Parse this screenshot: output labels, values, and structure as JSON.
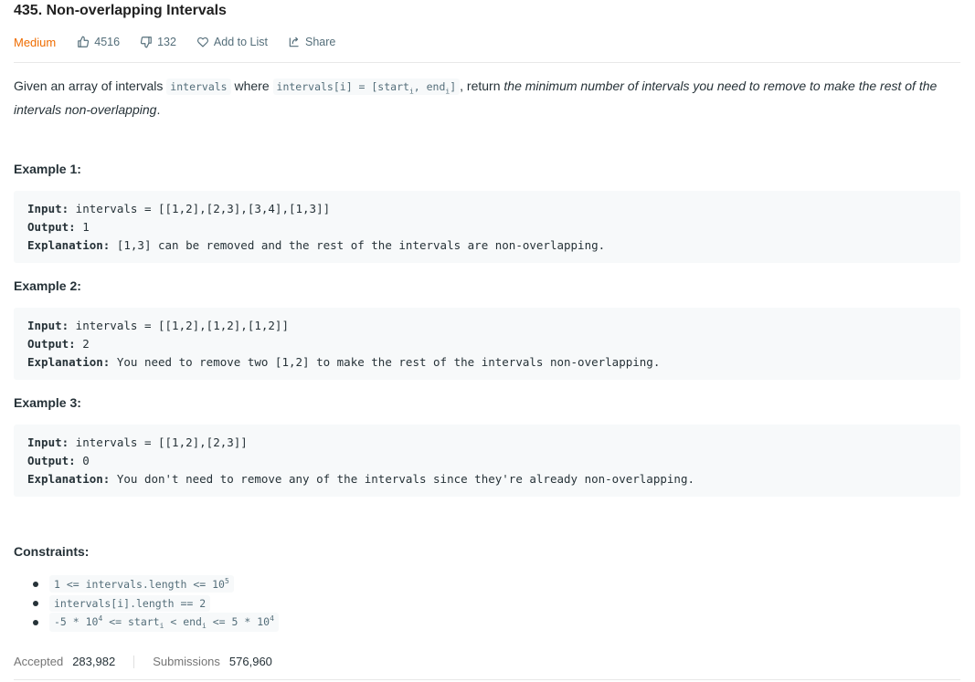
{
  "problem": {
    "title": "435. Non-overlapping Intervals",
    "difficulty": "Medium",
    "likes": "4516",
    "dislikes": "132",
    "add_to_list": "Add to List",
    "share": "Share"
  },
  "description": {
    "p1": "Given an array of intervals ",
    "code1": "intervals",
    "p2": " where ",
    "code2_a": "intervals[i] = [start",
    "code2_sub1": "i",
    "code2_b": ", end",
    "code2_sub2": "i",
    "code2_c": "]",
    "p3": ", return ",
    "p4_em": "the minimum number of intervals you need to remove to make the rest of the intervals non-overlapping",
    "p5": "."
  },
  "examples": [
    {
      "heading": "Example 1:",
      "input_label": "Input:",
      "input": " intervals = [[1,2],[2,3],[3,4],[1,3]]",
      "output_label": "Output:",
      "output": " 1",
      "explanation_label": "Explanation:",
      "explanation": " [1,3] can be removed and the rest of the intervals are non-overlapping."
    },
    {
      "heading": "Example 2:",
      "input_label": "Input:",
      "input": " intervals = [[1,2],[1,2],[1,2]]",
      "output_label": "Output:",
      "output": " 2",
      "explanation_label": "Explanation:",
      "explanation": " You need to remove two [1,2] to make the rest of the intervals non-overlapping."
    },
    {
      "heading": "Example 3:",
      "input_label": "Input:",
      "input": " intervals = [[1,2],[2,3]]",
      "output_label": "Output:",
      "output": " 0",
      "explanation_label": "Explanation:",
      "explanation": " You don't need to remove any of the intervals since they're already non-overlapping."
    }
  ],
  "constraints": {
    "heading": "Constraints:",
    "c1_a": "1 <= intervals.length <= 10",
    "c1_sup": "5",
    "c2": "intervals[i].length == 2",
    "c3_a": "-5 * 10",
    "c3_sup1": "4",
    "c3_b": " <= start",
    "c3_sub1": "i",
    "c3_c": " < end",
    "c3_sub2": "i",
    "c3_d": " <= 5 * 10",
    "c3_sup2": "4"
  },
  "stats": {
    "accepted_label": "Accepted",
    "accepted_value": "283,982",
    "submissions_label": "Submissions",
    "submissions_value": "576,960"
  },
  "colors": {
    "difficulty_medium": "#ef6c00",
    "code_bg": "#f7f9fa",
    "text": "#263238",
    "muted": "#546e7a"
  },
  "icons": [
    "thumbs-up-icon",
    "thumbs-down-icon",
    "heart-icon",
    "share-icon"
  ]
}
